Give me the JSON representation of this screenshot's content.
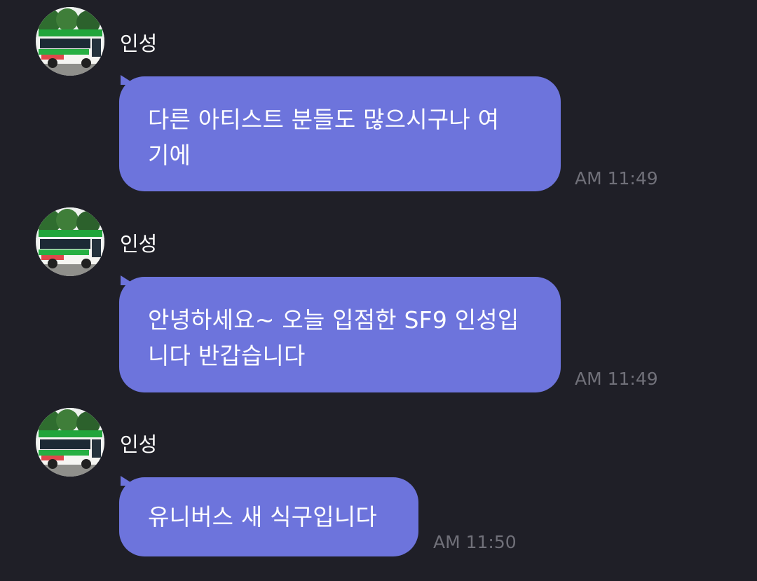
{
  "messages": [
    {
      "sender": "인성",
      "avatar_icon": "bus-avatar-icon",
      "lines": [
        "다른 아티스트 분들도 많으시구나 여",
        "기에"
      ],
      "time": "AM 11:49"
    },
    {
      "sender": "인성",
      "avatar_icon": "bus-avatar-icon",
      "lines": [
        "안녕하세요~ 오늘 입점한 SF9 인성입",
        "니다 반갑습니다"
      ],
      "time": "AM 11:49"
    },
    {
      "sender": "인성",
      "avatar_icon": "bus-avatar-icon",
      "lines": [
        "유니버스 새 식구입니다"
      ],
      "time": "AM 11:50"
    }
  ],
  "colors": {
    "background": "#1f1f27",
    "bubble": "#6d74dc",
    "sender_text": "#ffffff",
    "time_text": "#707079"
  }
}
